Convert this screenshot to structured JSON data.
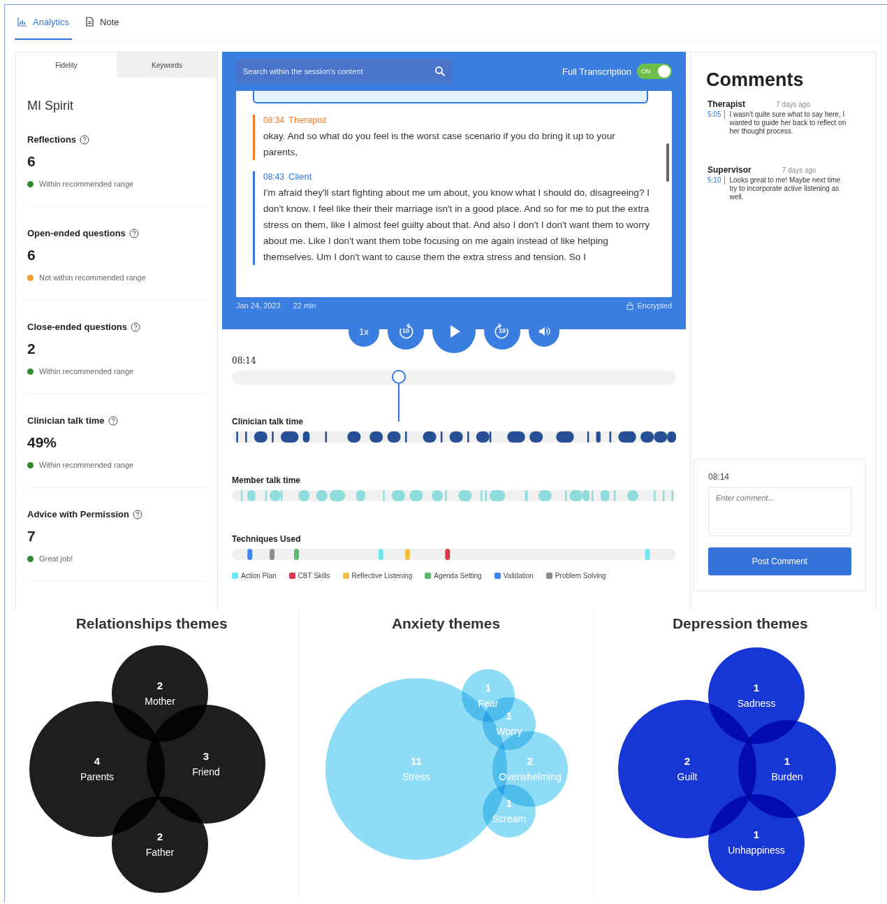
{
  "tabs": [
    {
      "label": "Analytics",
      "selected": true
    },
    {
      "label": "Note",
      "selected": false
    }
  ],
  "fidelity_panel": {
    "tabs": [
      {
        "label": "Fidelity",
        "selected": true
      },
      {
        "label": "Keywords",
        "selected": false
      }
    ],
    "title": "MI Spirit",
    "metrics": [
      {
        "name": "Reflections",
        "value": "6",
        "status": "Within recommended range",
        "color": "#2e8b2e"
      },
      {
        "name": "Open-ended questions",
        "value": "6",
        "status": "Not within recommended range",
        "color": "#f39c2b"
      },
      {
        "name": "Close-ended questions",
        "value": "2",
        "status": "Within recommended range",
        "color": "#2e8b2e"
      },
      {
        "name": "Clinician talk time",
        "value": "49%",
        "status": "Within recommended range",
        "color": "#2e8b2e"
      },
      {
        "name": "Advice with Permission",
        "value": "7",
        "status": "Great job!",
        "color": "#2e8b2e"
      }
    ]
  },
  "player": {
    "search": {
      "placeholder": "Search within the session's content"
    },
    "transcription_toggle": {
      "label": "Full Transcription",
      "on": true,
      "state_text": "ON"
    },
    "transcript": [
      {
        "time": "08:34",
        "speaker": "Therapist",
        "kind": "therapist",
        "text": "okay. And so what do you feel is the worst case scenario if you do bring it up to your parents,"
      },
      {
        "time": "08:43",
        "speaker": "Client",
        "kind": "client",
        "text": "I'm afraid they'll start fighting about me um about, you know what I should do, disagreeing? I don't know. I feel like their their marriage isn't in a good place. And so for me to put the extra stress on them, like I almost feel guilty about that. And also I don't I don't want them to worry about me. Like I don't want them tobe focusing on me again instead of like helping themselves. Um I don't want to cause them the extra stress and tension. So I"
      }
    ],
    "date": "Jan 24, 2023",
    "duration": "22 min",
    "security": "Encrypted",
    "controls": [
      {
        "kind": "speed",
        "label": "1x"
      },
      {
        "kind": "rewind",
        "label": "10"
      },
      {
        "kind": "play"
      },
      {
        "kind": "forward",
        "label": "10"
      },
      {
        "kind": "volume"
      }
    ]
  },
  "timeline": {
    "current_time": "08:14",
    "level": 0.375,
    "tracks": [
      {
        "label": "Clinician talk time",
        "kind": "clinician"
      },
      {
        "label": "Member talk time",
        "kind": "member"
      }
    ],
    "techniques": {
      "label": "Techniques Used",
      "legend": [
        {
          "label": "Action Plan",
          "color": "#6ee7f0"
        },
        {
          "label": "CBT Skills",
          "color": "#d8384a"
        },
        {
          "label": "Reflective Listening",
          "color": "#f2c040"
        },
        {
          "label": "Agenda Setting",
          "color": "#5cb86e"
        },
        {
          "label": "Validation",
          "color": "#3f86f0"
        },
        {
          "label": "Problem Solving",
          "color": "#8c8c8c"
        }
      ]
    }
  },
  "comments": {
    "title": "Comments",
    "items": [
      {
        "author": "Therapist",
        "ago": "7 days ago",
        "timestamp": "5:05",
        "text": "I wasn't quite sure what to say here, I wanted to guide her back to reflect on her thought process."
      },
      {
        "author": "Supervisor",
        "ago": "7 days ago",
        "timestamp": "5:10",
        "text": "Looks great to me! Maybe next time try to incorporate active listening as well."
      }
    ],
    "form": {
      "time": "08:14",
      "placeholder": "Enter comment...",
      "button": "Post Comment"
    }
  },
  "themes": [
    {
      "title": "Relationships themes",
      "color": "#1e1e1e",
      "bubbles": [
        {
          "count": "2",
          "label": "Mother"
        },
        {
          "count": "4",
          "label": "Parents"
        },
        {
          "count": "3",
          "label": "Friend"
        },
        {
          "count": "2",
          "label": "Father"
        }
      ]
    },
    {
      "title": "Anxiety themes",
      "color": "#8edcf6",
      "bubbles": [
        {
          "count": "11",
          "label": "Stress"
        },
        {
          "count": "1",
          "label": "Fear"
        },
        {
          "count": "1",
          "label": "Worry"
        },
        {
          "count": "2",
          "label": "Overwhelming"
        },
        {
          "count": "1",
          "label": "Scream"
        }
      ]
    },
    {
      "title": "Depression themes",
      "color": "#1736d6",
      "bubbles": [
        {
          "count": "1",
          "label": "Sadness"
        },
        {
          "count": "2",
          "label": "Guilt"
        },
        {
          "count": "1",
          "label": "Burden"
        },
        {
          "count": "1",
          "label": "Unhappiness"
        }
      ]
    }
  ]
}
